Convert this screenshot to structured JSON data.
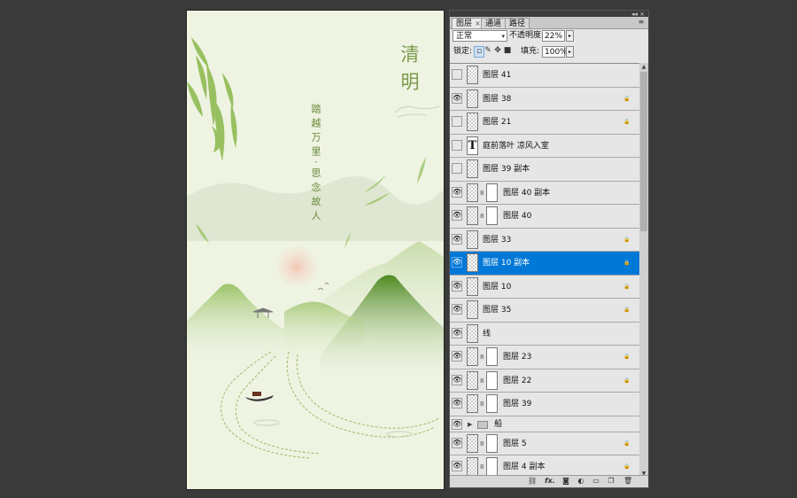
{
  "canvas": {
    "title_vertical": "清明",
    "poem_line1": "踏越万里",
    "poem_line2": "思念故人",
    "poem_separator": "·"
  },
  "panel": {
    "tabs": [
      {
        "label": "图层",
        "active": true,
        "close": "×"
      },
      {
        "label": "通道",
        "active": false
      },
      {
        "label": "路径",
        "active": false
      }
    ],
    "panel_menu": "≡",
    "window_controls": "◂◂ ×",
    "blend_mode": "正常",
    "opacity_label": "不透明度:",
    "opacity_value": "22%",
    "lock_label": "锁定:",
    "fill_label": "填充:",
    "fill_value": "100%",
    "step_arrow": "▸",
    "dropdown_arrow": "▾"
  },
  "layers": [
    {
      "name": "图层 41",
      "visible": false,
      "mask": false,
      "locked": false,
      "text": false
    },
    {
      "name": "图层 38",
      "visible": true,
      "mask": false,
      "locked": true,
      "text": false
    },
    {
      "name": "图层 21",
      "visible": false,
      "mask": false,
      "locked": true,
      "text": false
    },
    {
      "name": "庭前落叶 凉风入室",
      "visible": false,
      "mask": false,
      "locked": false,
      "text": true
    },
    {
      "name": "图层 39 副本",
      "visible": false,
      "mask": false,
      "locked": false,
      "text": false
    },
    {
      "name": "图层 40 副本",
      "visible": true,
      "mask": true,
      "locked": false,
      "text": false
    },
    {
      "name": "图层 40",
      "visible": true,
      "mask": true,
      "locked": false,
      "text": false
    },
    {
      "name": "图层 33",
      "visible": true,
      "mask": false,
      "locked": true,
      "text": false
    },
    {
      "name": "图层 10 副本",
      "visible": true,
      "mask": false,
      "locked": true,
      "text": false,
      "selected": true
    },
    {
      "name": "图层 10",
      "visible": true,
      "mask": false,
      "locked": true,
      "text": false
    },
    {
      "name": "图层 35",
      "visible": true,
      "mask": false,
      "locked": true,
      "text": false
    },
    {
      "name": "线",
      "visible": true,
      "mask": false,
      "locked": false,
      "text": false
    },
    {
      "name": "图层 23",
      "visible": true,
      "mask": true,
      "locked": true,
      "text": false
    },
    {
      "name": "图层 22",
      "visible": true,
      "mask": true,
      "locked": true,
      "text": false
    },
    {
      "name": "图层 39",
      "visible": true,
      "mask": true,
      "locked": false,
      "text": false
    },
    {
      "name": "船",
      "visible": true,
      "group": true
    },
    {
      "name": "图层 5",
      "visible": true,
      "mask": true,
      "locked": true,
      "text": false
    },
    {
      "name": "图层 4 副本",
      "visible": true,
      "mask": true,
      "locked": true,
      "text": false
    }
  ],
  "icons": {
    "eye": "👁",
    "lock": "🔒",
    "text_layer": "T",
    "chain": "8"
  },
  "footer_icons": [
    "link-icon",
    "fx-icon",
    "mask-icon",
    "adjustment-icon",
    "group-icon",
    "new-layer-icon",
    "trash-icon"
  ],
  "footer_labels": {
    "link": "⛓",
    "fx": "fx.",
    "mask": "◙",
    "adjust": "◐",
    "group": "▭",
    "new": "❐",
    "trash": "🗑"
  },
  "colors": {
    "selected": "#0078d7",
    "bamboo_green": "#7aa83a",
    "background": "#eef3e2"
  }
}
